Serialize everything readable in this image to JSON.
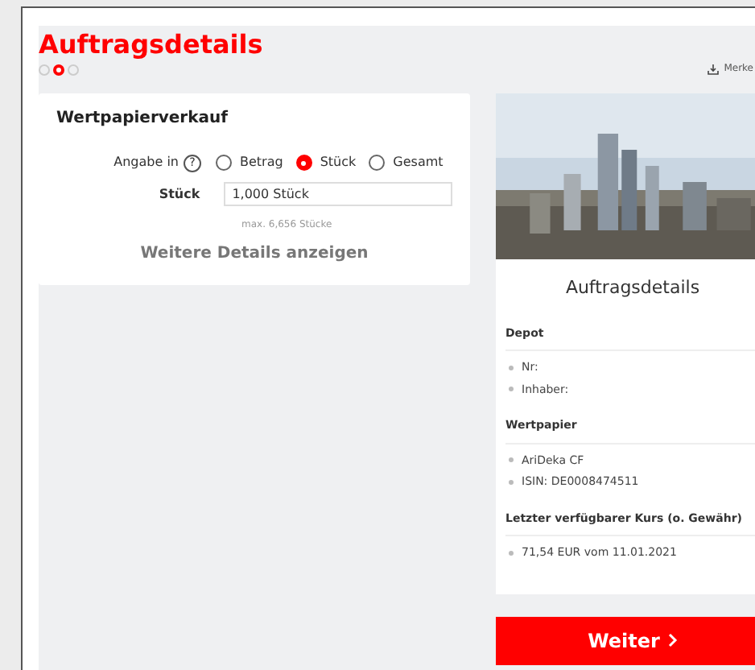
{
  "page": {
    "title": "Auftragsdetails"
  },
  "steps": [
    {
      "selected": false
    },
    {
      "selected": true
    },
    {
      "selected": false
    }
  ],
  "merken": {
    "label": "Merke"
  },
  "form": {
    "title": "Wertpapierverkauf",
    "angabe_label": "Angabe in",
    "help": "?",
    "options": [
      {
        "label": "Betrag",
        "selected": false
      },
      {
        "label": "Stück",
        "selected": true
      },
      {
        "label": "Gesamt",
        "selected": false
      }
    ],
    "field_label": "Stück",
    "field_value": "1,000 Stück",
    "hint": "max. 6,656 Stücke",
    "more": "Weitere Details anzeigen"
  },
  "summary": {
    "title": "Auftragsdetails",
    "sections": [
      {
        "heading": "Depot",
        "items": [
          "Nr:",
          "Inhaber:"
        ]
      },
      {
        "heading": "Wertpapier",
        "items": [
          "AriDeka CF",
          "ISIN: DE0008474511"
        ]
      },
      {
        "heading": "Letzter verfügbarer Kurs (o. Gewähr)",
        "items": [
          "71,54 EUR vom 11.01.2021"
        ]
      }
    ]
  },
  "next": {
    "label": "Weiter"
  }
}
